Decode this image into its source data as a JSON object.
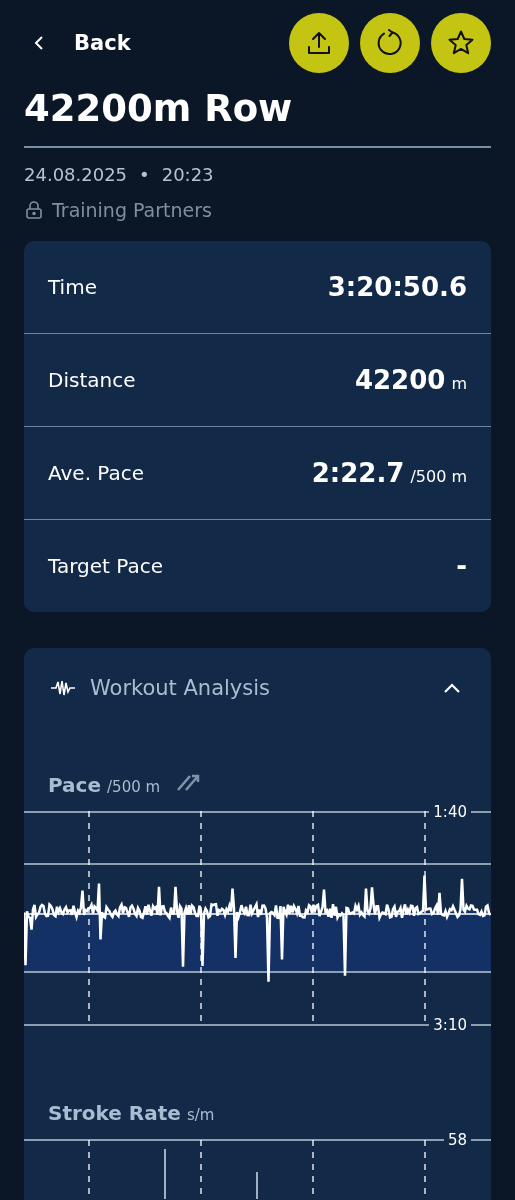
{
  "header": {
    "back_label": "Back"
  },
  "title": "42200m Row",
  "date": "24.08.2025",
  "separator": "•",
  "time": "20:23",
  "visibility": "Training Partners",
  "stats": [
    {
      "label": "Time",
      "value": "3:20:50.6"
    },
    {
      "label": "Distance",
      "value": "42200",
      "unit": "m"
    },
    {
      "label": "Ave. Pace",
      "value": "2:22.7",
      "unit": "/500 m"
    },
    {
      "label": "Target Pace",
      "value": "-"
    }
  ],
  "analysis": {
    "title": "Workout Analysis",
    "expanded": true,
    "charts": [
      {
        "kind": "pace",
        "title": "Pace",
        "unit": "/500 m",
        "top_label": "1:40",
        "bottom_label": "3:10"
      },
      {
        "kind": "rate",
        "title": "Stroke Rate",
        "unit": "s/m",
        "top_label": "58"
      }
    ]
  }
}
